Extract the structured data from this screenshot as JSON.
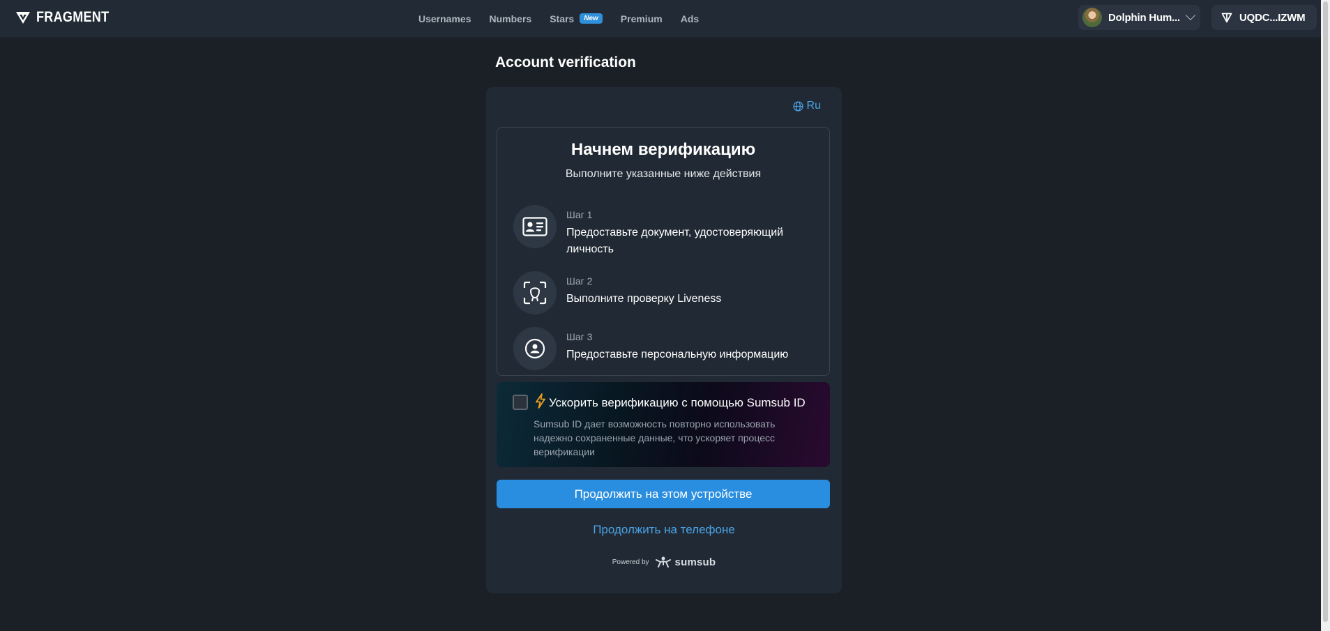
{
  "header": {
    "logo_text": "FRAGMENT",
    "nav": [
      {
        "label": "Usernames"
      },
      {
        "label": "Numbers"
      },
      {
        "label": "Stars",
        "badge": "New"
      },
      {
        "label": "Premium"
      },
      {
        "label": "Ads"
      }
    ],
    "user_name": "Dolphin Hum...",
    "wallet_address": "UQDC...IZWM"
  },
  "page": {
    "title": "Account verification"
  },
  "card": {
    "language": "Ru",
    "heading": "Начнем верификацию",
    "subheading": "Выполните указанные ниже действия",
    "steps": [
      {
        "label": "Шаг 1",
        "text": "Предоставьте документ, удостоверяющий личность",
        "icon": "id-card-icon"
      },
      {
        "label": "Шаг 2",
        "text": "Выполните проверку Liveness",
        "icon": "face-scan-icon"
      },
      {
        "label": "Шаг 3",
        "text": "Предоставьте персональную информацию",
        "icon": "person-circle-icon"
      }
    ],
    "sumsub_id": {
      "title": "Ускорить верификацию с помощью Sumsub ID",
      "description": "Sumsub ID дает возможность повторно использовать надежно сохраненные данные, что ускоряет процесс верификации",
      "checked": false
    },
    "primary_button": "Продолжить на этом устройстве",
    "phone_link": "Продолжить на телефоне",
    "powered_by": "Powered by",
    "powered_brand": "sumsub"
  },
  "colors": {
    "background": "#1a2026",
    "header": "#222b35",
    "card": "#212a34",
    "accent": "#2a8ee0",
    "link": "#4aa3e6"
  }
}
